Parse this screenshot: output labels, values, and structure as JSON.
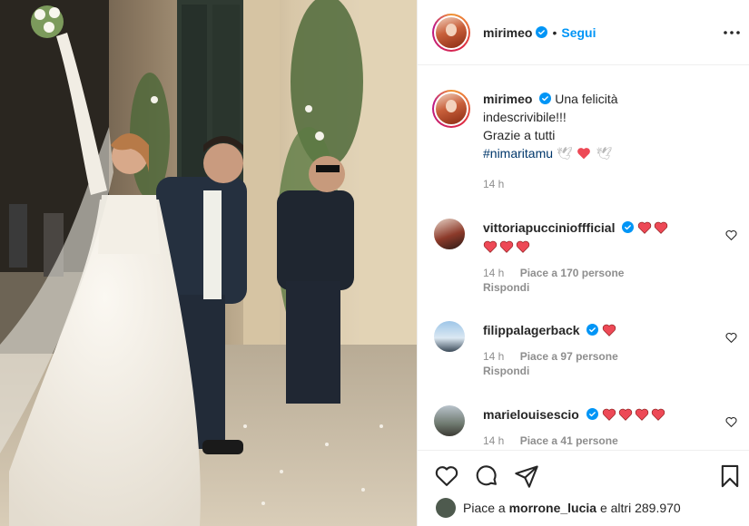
{
  "post": {
    "author": "mirimeo",
    "follow_label": "Segui",
    "dot": "•"
  },
  "caption": {
    "author": "mirimeo",
    "line1": "Una felicità",
    "line2": "indescrivibile!!!",
    "line3": "Grazie a tutti",
    "hashtag": "#nimaritamu",
    "time": "14 h"
  },
  "comments": [
    {
      "author": "vittoriapuccinioffficial",
      "hearts_inline": 2,
      "hearts_second_line": 3,
      "time": "14 h",
      "likes": "Piace a 170 persone",
      "reply": "Rispondi"
    },
    {
      "author": "filippalagerback",
      "hearts_inline": 1,
      "time": "14 h",
      "likes": "Piace a 97 persone",
      "reply": "Rispondi"
    },
    {
      "author": "marielouisescio",
      "hearts_inline": 4,
      "time": "14 h",
      "likes": "Piace a 41 persone"
    }
  ],
  "footer": {
    "likes_prefix": "Piace a",
    "likes_user": "morrone_lucia",
    "likes_suffix": "e altri 289.970"
  },
  "colors": {
    "accent": "#0095f6",
    "heart": "#ed4956",
    "muted": "#8e8e8e",
    "hashtag": "#00376b"
  }
}
